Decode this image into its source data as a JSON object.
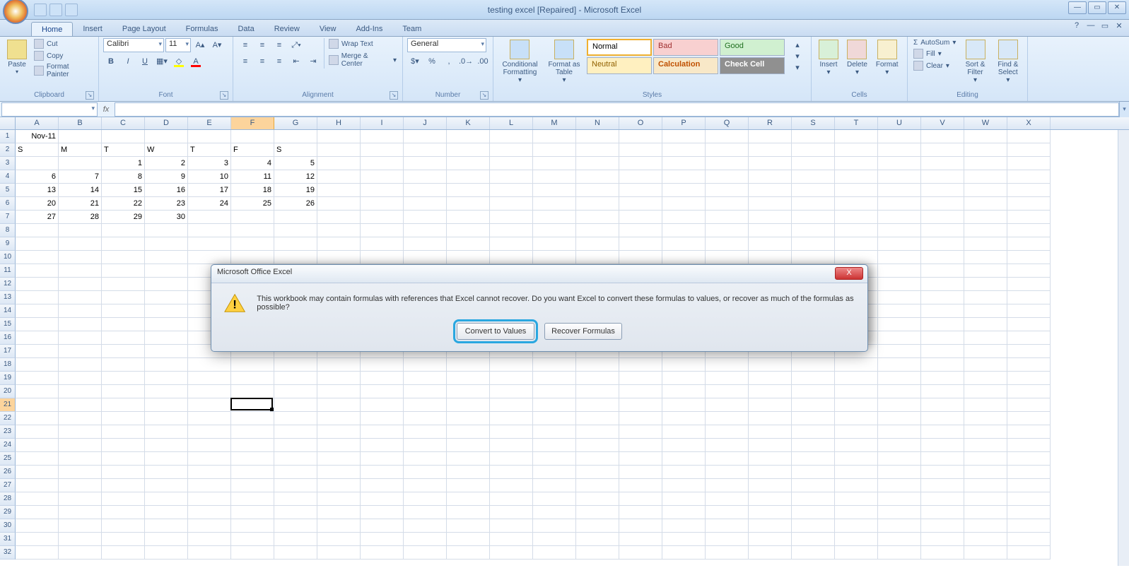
{
  "window": {
    "title": "testing excel [Repaired] - Microsoft Excel"
  },
  "tabs": [
    "Home",
    "Insert",
    "Page Layout",
    "Formulas",
    "Data",
    "Review",
    "View",
    "Add-Ins",
    "Team"
  ],
  "active_tab": "Home",
  "ribbon": {
    "clipboard": {
      "label": "Clipboard",
      "paste": "Paste",
      "cut": "Cut",
      "copy": "Copy",
      "format_painter": "Format Painter"
    },
    "font": {
      "label": "Font",
      "name": "Calibri",
      "size": "11",
      "bold": "B",
      "italic": "I",
      "underline": "U"
    },
    "alignment": {
      "label": "Alignment",
      "wrap": "Wrap Text",
      "merge": "Merge & Center"
    },
    "number": {
      "label": "Number",
      "format": "General"
    },
    "styles": {
      "label": "Styles",
      "conditional": "Conditional Formatting",
      "format_table": "Format as Table",
      "normal": "Normal",
      "bad": "Bad",
      "good": "Good",
      "neutral": "Neutral",
      "calculation": "Calculation",
      "check": "Check Cell"
    },
    "cells": {
      "label": "Cells",
      "insert": "Insert",
      "delete": "Delete",
      "format": "Format"
    },
    "editing": {
      "label": "Editing",
      "autosum": "AutoSum",
      "fill": "Fill",
      "clear": "Clear",
      "sort": "Sort & Filter",
      "find": "Find & Select"
    }
  },
  "formula_bar": {
    "name_box": "",
    "fx": "fx"
  },
  "columns": [
    "A",
    "B",
    "C",
    "D",
    "E",
    "F",
    "G",
    "H",
    "I",
    "J",
    "K",
    "L",
    "M",
    "N",
    "O",
    "P",
    "Q",
    "R",
    "S",
    "T",
    "U",
    "V",
    "W",
    "X"
  ],
  "selected_col_index": 5,
  "selected_row": 21,
  "cell_data": {
    "1": {
      "A": {
        "v": "Nov-11",
        "align": "right"
      }
    },
    "2": {
      "A": {
        "v": "S"
      },
      "B": {
        "v": "M"
      },
      "C": {
        "v": "T"
      },
      "D": {
        "v": "W"
      },
      "E": {
        "v": "T"
      },
      "F": {
        "v": "F"
      },
      "G": {
        "v": "S"
      }
    },
    "3": {
      "C": {
        "v": "1",
        "align": "right"
      },
      "D": {
        "v": "2",
        "align": "right"
      },
      "E": {
        "v": "3",
        "align": "right"
      },
      "F": {
        "v": "4",
        "align": "right"
      },
      "G": {
        "v": "5",
        "align": "right"
      }
    },
    "4": {
      "A": {
        "v": "6",
        "align": "right"
      },
      "B": {
        "v": "7",
        "align": "right"
      },
      "C": {
        "v": "8",
        "align": "right"
      },
      "D": {
        "v": "9",
        "align": "right"
      },
      "E": {
        "v": "10",
        "align": "right"
      },
      "F": {
        "v": "11",
        "align": "right"
      },
      "G": {
        "v": "12",
        "align": "right"
      }
    },
    "5": {
      "A": {
        "v": "13",
        "align": "right"
      },
      "B": {
        "v": "14",
        "align": "right"
      },
      "C": {
        "v": "15",
        "align": "right"
      },
      "D": {
        "v": "16",
        "align": "right"
      },
      "E": {
        "v": "17",
        "align": "right"
      },
      "F": {
        "v": "18",
        "align": "right"
      },
      "G": {
        "v": "19",
        "align": "right"
      }
    },
    "6": {
      "A": {
        "v": "20",
        "align": "right"
      },
      "B": {
        "v": "21",
        "align": "right"
      },
      "C": {
        "v": "22",
        "align": "right"
      },
      "D": {
        "v": "23",
        "align": "right"
      },
      "E": {
        "v": "24",
        "align": "right"
      },
      "F": {
        "v": "25",
        "align": "right"
      },
      "G": {
        "v": "26",
        "align": "right"
      }
    },
    "7": {
      "A": {
        "v": "27",
        "align": "right"
      },
      "B": {
        "v": "28",
        "align": "right"
      },
      "C": {
        "v": "29",
        "align": "right"
      },
      "D": {
        "v": "30",
        "align": "right"
      }
    }
  },
  "visible_rows": 32,
  "dialog": {
    "title": "Microsoft Office Excel",
    "message": "This workbook may contain formulas with references that Excel cannot recover. Do you want Excel to convert these formulas to values, or recover as much of the formulas as possible?",
    "primary": "Convert to Values",
    "secondary": "Recover Formulas"
  }
}
